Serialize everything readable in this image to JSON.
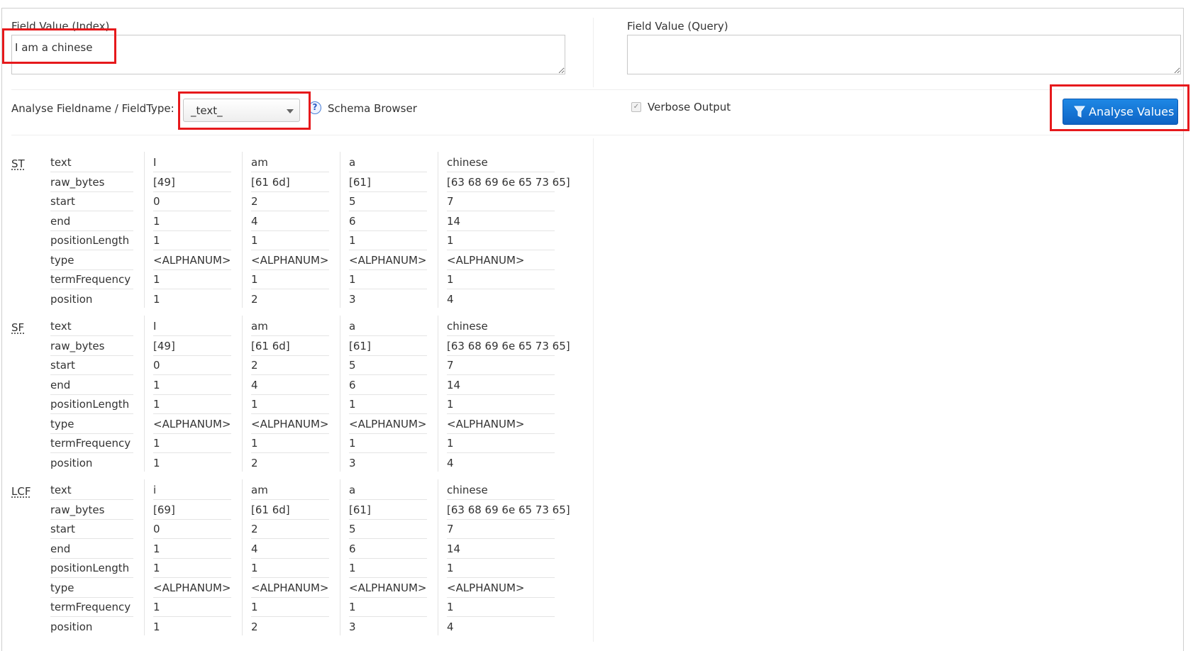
{
  "index_field": {
    "label": "Field Value (Index)",
    "value": "I am a chinese"
  },
  "query_field": {
    "label": "Field Value (Query)",
    "value": ""
  },
  "fieldtype": {
    "label": "Analyse Fieldname / FieldType:",
    "selected": "_text_",
    "schema_browser": "Schema Browser",
    "help_icon": "question-circle-icon"
  },
  "verbose": {
    "label": "Verbose Output",
    "checked": true
  },
  "analyse_button": {
    "label": "Analyse Values",
    "icon": "filter-icon"
  },
  "highlight_color": "#e6191c",
  "accent_color": "#1a7fe0",
  "attributes": [
    "text",
    "raw_bytes",
    "start",
    "end",
    "positionLength",
    "type",
    "termFrequency",
    "position"
  ],
  "stages": [
    {
      "abbr": "ST",
      "tokens": [
        [
          "I",
          "[49]",
          "0",
          "1",
          "1",
          "<ALPHANUM>",
          "1",
          "1"
        ],
        [
          "am",
          "[61 6d]",
          "2",
          "4",
          "1",
          "<ALPHANUM>",
          "1",
          "2"
        ],
        [
          "a",
          "[61]",
          "5",
          "6",
          "1",
          "<ALPHANUM>",
          "1",
          "3"
        ],
        [
          "chinese",
          "[63 68 69 6e 65 73 65]",
          "7",
          "14",
          "1",
          "<ALPHANUM>",
          "1",
          "4"
        ]
      ]
    },
    {
      "abbr": "SF",
      "tokens": [
        [
          "I",
          "[49]",
          "0",
          "1",
          "1",
          "<ALPHANUM>",
          "1",
          "1"
        ],
        [
          "am",
          "[61 6d]",
          "2",
          "4",
          "1",
          "<ALPHANUM>",
          "1",
          "2"
        ],
        [
          "a",
          "[61]",
          "5",
          "6",
          "1",
          "<ALPHANUM>",
          "1",
          "3"
        ],
        [
          "chinese",
          "[63 68 69 6e 65 73 65]",
          "7",
          "14",
          "1",
          "<ALPHANUM>",
          "1",
          "4"
        ]
      ]
    },
    {
      "abbr": "LCF",
      "tokens": [
        [
          "i",
          "[69]",
          "0",
          "1",
          "1",
          "<ALPHANUM>",
          "1",
          "1"
        ],
        [
          "am",
          "[61 6d]",
          "2",
          "4",
          "1",
          "<ALPHANUM>",
          "1",
          "2"
        ],
        [
          "a",
          "[61]",
          "5",
          "6",
          "1",
          "<ALPHANUM>",
          "1",
          "3"
        ],
        [
          "chinese",
          "[63 68 69 6e 65 73 65]",
          "7",
          "14",
          "1",
          "<ALPHANUM>",
          "1",
          "4"
        ]
      ]
    }
  ]
}
